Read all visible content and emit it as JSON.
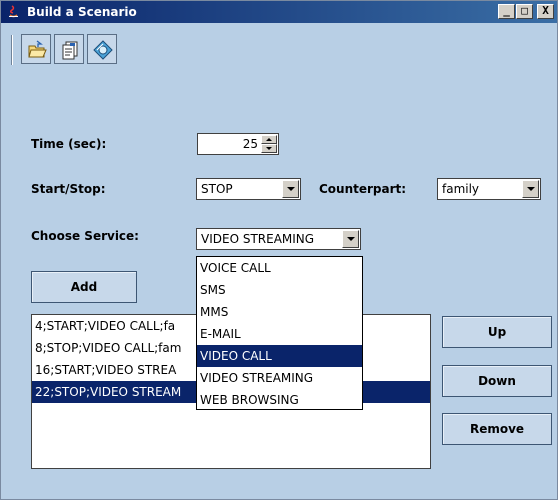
{
  "window": {
    "title": "Build a Scenario",
    "controls": {
      "minimize": "_",
      "maximize": "□",
      "close": "X"
    }
  },
  "toolbar": {
    "buttons": [
      {
        "name": "open-file",
        "icon": "open-folder-icon"
      },
      {
        "name": "save-file",
        "icon": "save-document-icon"
      },
      {
        "name": "run",
        "icon": "disc-icon"
      }
    ]
  },
  "form": {
    "time_label": "Time (sec):",
    "time_value": "25",
    "startstop_label": "Start/Stop:",
    "startstop_value": "STOP",
    "counterpart_label": "Counterpart:",
    "counterpart_value": "family",
    "service_label": "Choose Service:",
    "service_value": "VIDEO STREAMING"
  },
  "service_options": [
    "VOICE CALL",
    "SMS",
    "MMS",
    "E-MAIL",
    "VIDEO CALL",
    "VIDEO STREAMING",
    "WEB BROWSING"
  ],
  "service_highlighted": "VIDEO CALL",
  "buttons": {
    "add": "Add",
    "up": "Up",
    "down": "Down",
    "remove": "Remove"
  },
  "scenario_list": [
    "4;START;VIDEO CALL;fa",
    "8;STOP;VIDEO CALL;fam",
    "16;START;VIDEO STREA",
    "22;STOP;VIDEO STREAM"
  ],
  "scenario_selected_index": 3,
  "colors": {
    "window_bg": "#b8cfe5",
    "titlebar": "#0a246a",
    "selection": "#0a246a"
  }
}
